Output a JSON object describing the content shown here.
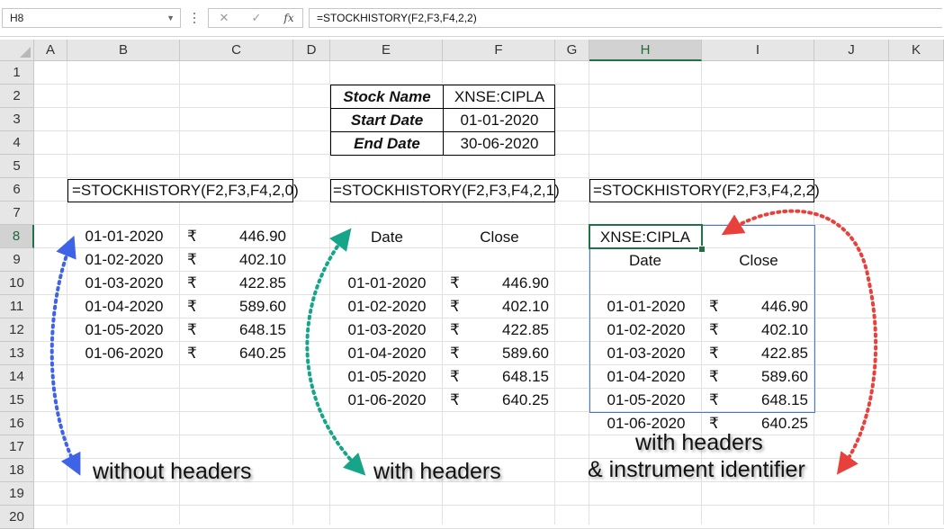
{
  "formula_bar": {
    "name_box": "H8",
    "cancel_icon": "✕",
    "enter_icon": "✓",
    "fx_label": "fx",
    "formula": "=STOCKHISTORY(F2,F3,F4,2,2)"
  },
  "columns": [
    "A",
    "B",
    "C",
    "D",
    "E",
    "F",
    "G",
    "H",
    "I",
    "J",
    "K"
  ],
  "rows": [
    "1",
    "2",
    "3",
    "4",
    "5",
    "6",
    "7",
    "8",
    "9",
    "10",
    "11",
    "12",
    "13",
    "14",
    "15",
    "16",
    "17",
    "18",
    "19",
    "20"
  ],
  "selected_cell": {
    "column": "H",
    "row": "8"
  },
  "params": {
    "labels": [
      "Stock Name",
      "Start Date",
      "End Date"
    ],
    "values": [
      "XNSE:CIPLA",
      "01-01-2020",
      "30-06-2020"
    ]
  },
  "formulas": {
    "no_headers": "=STOCKHISTORY(F2,F3,F4,2,0)",
    "headers": "=STOCKHISTORY(F2,F3,F4,2,1)",
    "headers_id": "=STOCKHISTORY(F2,F3,F4,2,2)"
  },
  "currency_symbol": "₹",
  "history": {
    "dates": [
      "01-01-2020",
      "01-02-2020",
      "01-03-2020",
      "01-04-2020",
      "01-05-2020",
      "01-06-2020"
    ],
    "closes": [
      "446.90",
      "402.10",
      "422.85",
      "589.60",
      "648.15",
      "640.25"
    ]
  },
  "headers": {
    "date": "Date",
    "close": "Close"
  },
  "instrument": "XNSE:CIPLA",
  "notes": {
    "without_headers": "without headers",
    "with_headers": "with headers",
    "with_headers_id_line1": "with headers",
    "with_headers_id_line2": "& instrument identifier"
  },
  "colors": {
    "arrow_blue": "#3f63e6",
    "arrow_green": "#17a589",
    "arrow_red": "#e8413c",
    "selection_green": "#217346"
  }
}
